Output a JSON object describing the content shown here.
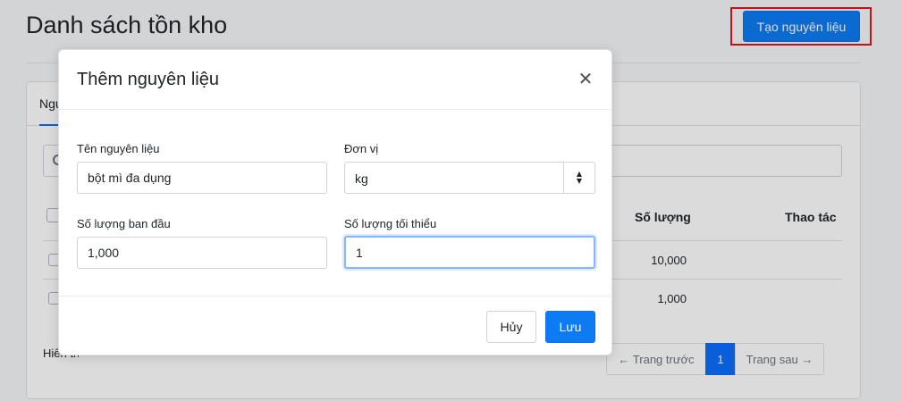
{
  "page": {
    "title": "Danh sách tồn kho",
    "create_button": "Tạo nguyên liệu",
    "active_tab": "Nguyên liệu",
    "table": {
      "headers": {
        "quantity": "Số lượng",
        "actions": "Thao tác"
      },
      "rows": [
        {
          "quantity": "10,000"
        },
        {
          "quantity": "1,000"
        }
      ]
    },
    "footer_info": "Hiển thị",
    "pagination": {
      "prev": "← Trang trước",
      "current": "1",
      "next": "Trang sau →"
    }
  },
  "modal": {
    "title": "Thêm nguyên liệu",
    "close_symbol": "✕",
    "fields": {
      "name": {
        "label": "Tên nguyên liệu",
        "value": "bột mì đa dụng"
      },
      "unit": {
        "label": "Đơn vị",
        "value": "kg"
      },
      "initial_qty": {
        "label": "Số lượng ban đầu",
        "value": "1,000"
      },
      "min_qty": {
        "label": "Số lượng tối thiểu",
        "value": "1"
      }
    },
    "buttons": {
      "cancel": "Hủy",
      "save": "Lưu"
    }
  },
  "colors": {
    "primary": "#0d7cf2",
    "highlight": "#e5141d"
  }
}
